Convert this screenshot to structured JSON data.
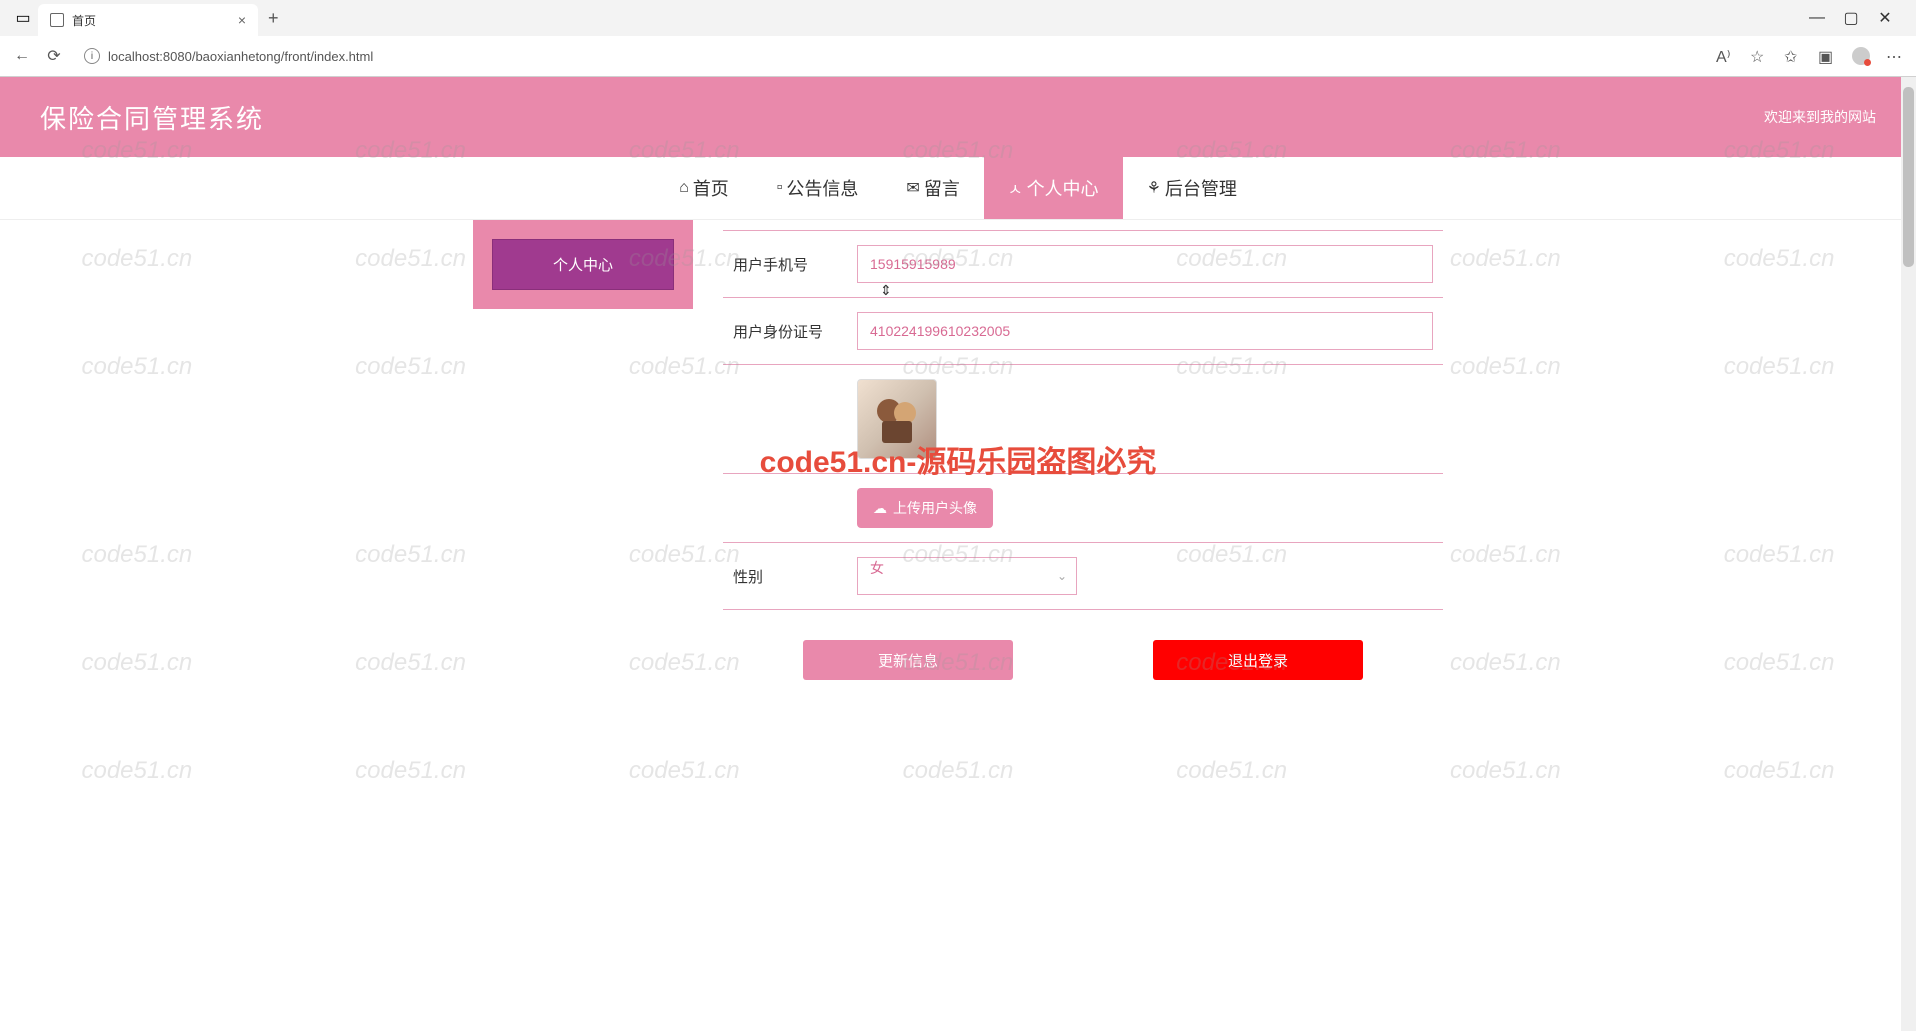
{
  "browser": {
    "tab_title": "首页",
    "url": "localhost:8080/baoxianhetong/front/index.html"
  },
  "header": {
    "title": "保险合同管理系统",
    "welcome": "欢迎来到我的网站"
  },
  "nav": {
    "items": [
      {
        "icon": "⌂",
        "label": "首页"
      },
      {
        "icon": "▫",
        "label": "公告信息"
      },
      {
        "icon": "✉",
        "label": "留言"
      },
      {
        "icon": "ㅅ",
        "label": "个人中心"
      },
      {
        "icon": "⚘",
        "label": "后台管理"
      }
    ]
  },
  "sidebar": {
    "items": [
      {
        "label": "个人中心"
      }
    ]
  },
  "form": {
    "phone_label": "用户手机号",
    "phone_value": "15915915989",
    "id_label": "用户身份证号",
    "id_value": "410224199610232005",
    "upload_label": "上传用户头像",
    "gender_label": "性别",
    "gender_value": "女",
    "update_btn": "更新信息",
    "logout_btn": "退出登录"
  },
  "watermark": {
    "text": "code51.cn",
    "center": "code51.cn-源码乐园盗图必究"
  }
}
